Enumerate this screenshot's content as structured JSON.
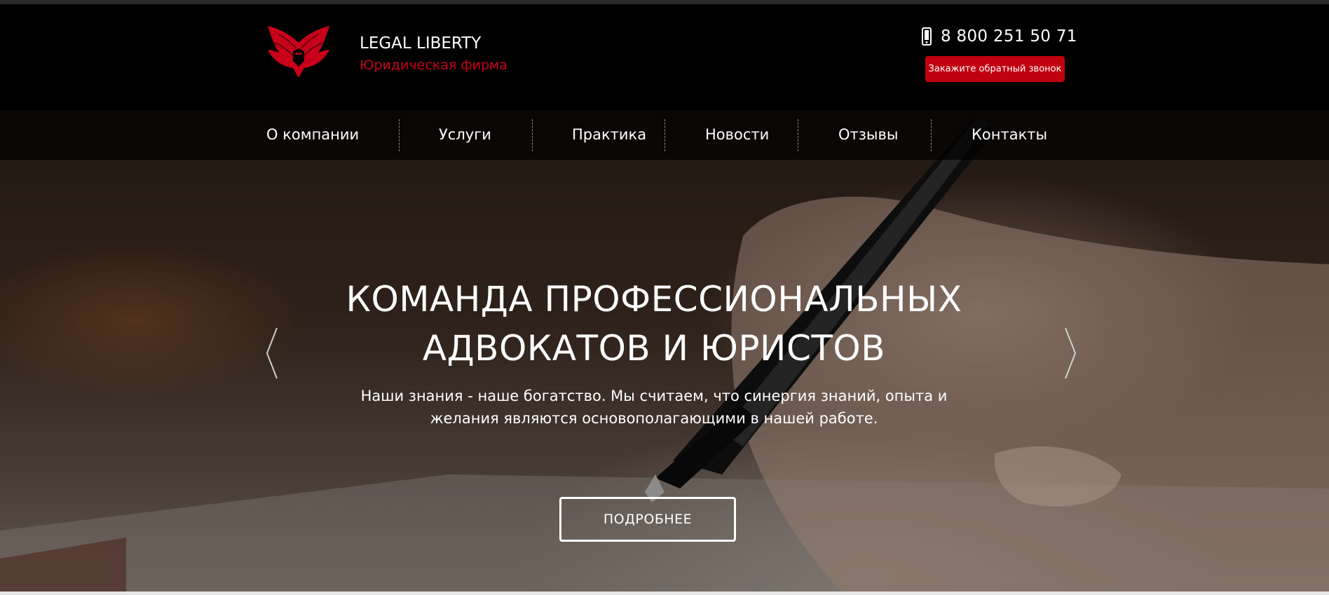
{
  "header": {
    "brand_name": "LEGAL LIBERTY",
    "brand_subtitle": "Юридическая фирма",
    "phone": "8 800 251 50 71",
    "callback_label": "Закажите обратный звонок"
  },
  "nav": {
    "items": [
      {
        "label": "О компании"
      },
      {
        "label": "Услуги"
      },
      {
        "label": "Практика"
      },
      {
        "label": "Новости"
      },
      {
        "label": "Отзывы"
      },
      {
        "label": "Контакты"
      }
    ]
  },
  "hero": {
    "title_line1": "КОМАНДА ПРОФЕССИОНАЛЬНЫХ",
    "title_line2": "АДВОКАТОВ И ЮРИСТОВ",
    "text_line1": "Наши знания - наше богатство. Мы считаем, что синергия знаний, опыта и",
    "text_line2": "желания являются основополагающими в нашей работе.",
    "button_label": "ПОДРОБНЕЕ"
  },
  "colors": {
    "accent": "#c0000f",
    "header_bg": "#000000",
    "text": "#ffffff"
  },
  "icons": {
    "logo": "winged-crown-shield-icon",
    "phone": "mobile-phone-icon",
    "prev": "chevron-left-icon",
    "next": "chevron-right-icon"
  }
}
